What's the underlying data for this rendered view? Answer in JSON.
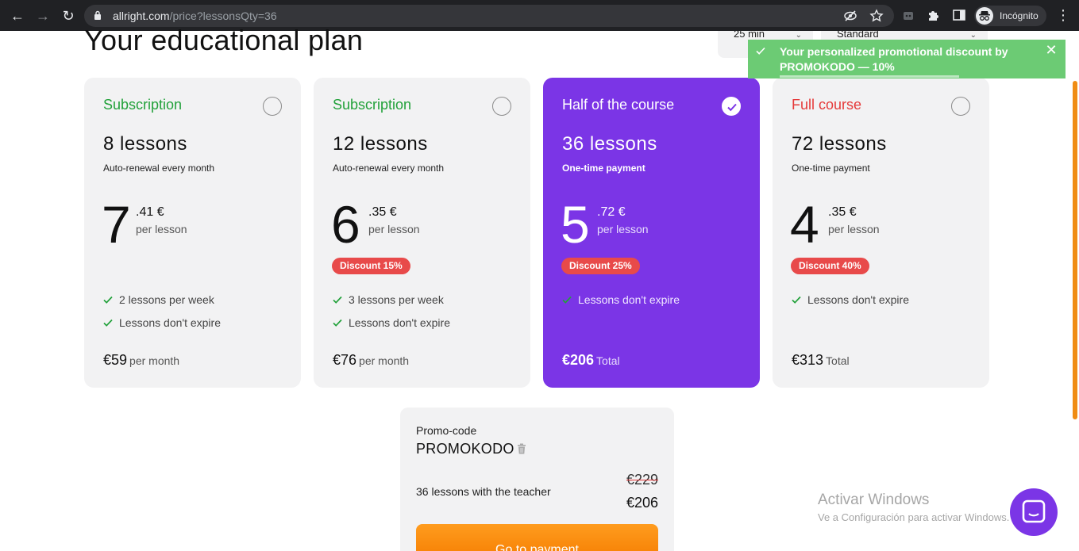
{
  "browser": {
    "url_host": "allright.com",
    "url_path": "/price?lessonsQty=36",
    "incognito_label": "Incógnito"
  },
  "page": {
    "title": "Your educational plan",
    "selectors": [
      {
        "value": "25 min"
      },
      {
        "value": "Standard"
      }
    ]
  },
  "toast": {
    "message": "Your personalized promotional discount by PROMOKODO — 10%",
    "close_symbol": "✕",
    "color": "#6ccb74"
  },
  "plans": [
    {
      "type": "Subscription",
      "type_color": "#22a13a",
      "lessons": "8 lessons",
      "payment": "Auto-renewal every month",
      "price_int": "7",
      "price_dec": ".41 €",
      "per_lesson": "per lesson",
      "discount": "",
      "features": [
        "2 lessons per week",
        "Lessons don't expire"
      ],
      "total": "€59",
      "total_suffix": "per month",
      "selected": false
    },
    {
      "type": "Subscription",
      "type_color": "#22a13a",
      "lessons": "12 lessons",
      "payment": "Auto-renewal every month",
      "price_int": "6",
      "price_dec": ".35 €",
      "per_lesson": "per lesson",
      "discount": "Discount 15%",
      "features": [
        "3 lessons per week",
        "Lessons don't expire"
      ],
      "total": "€76",
      "total_suffix": "per month",
      "selected": false
    },
    {
      "type": "Half of the course",
      "type_color": "#ffffff",
      "lessons": "36 lessons",
      "payment": "One-time payment",
      "price_int": "5",
      "price_dec": ".72 €",
      "per_lesson": "per lesson",
      "discount": "Discount 25%",
      "features": [
        "Lessons don't expire"
      ],
      "total": "€206",
      "total_suffix": "Total",
      "selected": true
    },
    {
      "type": "Full course",
      "type_color": "#e53a3a",
      "lessons": "72 lessons",
      "payment": "One-time payment",
      "price_int": "4",
      "price_dec": ".35 €",
      "per_lesson": "per lesson",
      "discount": "Discount 40%",
      "features": [
        "Lessons don't expire"
      ],
      "total": "€313",
      "total_suffix": "Total",
      "selected": false
    }
  ],
  "summary": {
    "promo_label": "Promo-code",
    "promo_code": "PROMOKODO",
    "description": "36 lessons with the teacher",
    "old_price": "€229",
    "new_price": "€206",
    "pay_button": "Go to payment"
  },
  "watermark": {
    "title": "Activar Windows",
    "subtitle": "Ve a Configuración para activar Windows."
  },
  "colors": {
    "accent_purple": "#7b35e6",
    "card_bg": "#f2f2f3",
    "discount_red": "#e84a4a",
    "pay_orange": "#f57c00"
  }
}
